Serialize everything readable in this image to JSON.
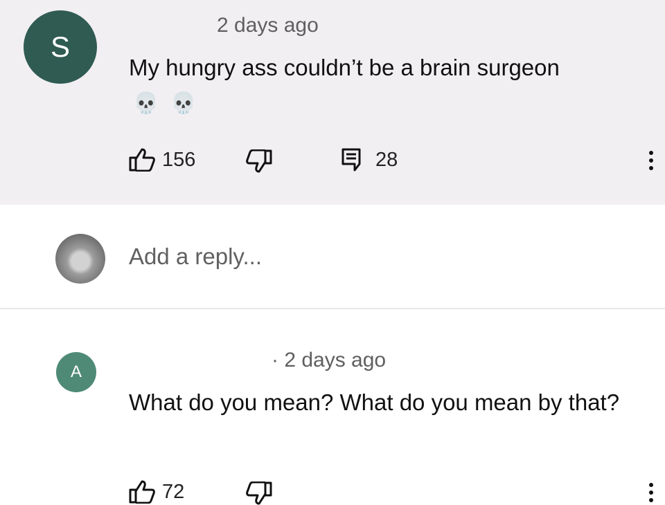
{
  "comment": {
    "avatar_letter": "S",
    "time": "2 days ago",
    "text": "My hungry ass couldn’t be a brain surgeon",
    "emoji": [
      "💀",
      "💀"
    ],
    "likes": "156",
    "replies": "28"
  },
  "reply_box": {
    "placeholder": "Add a reply..."
  },
  "reply": {
    "avatar_letter": "A",
    "time": "· 2 days ago",
    "text": "What do you mean? What do you mean by that?",
    "likes": "72"
  },
  "colors": {
    "comment_background": "#f2eff2",
    "avatar_s": "#2f5b52",
    "avatar_a": "#4f8a77"
  }
}
